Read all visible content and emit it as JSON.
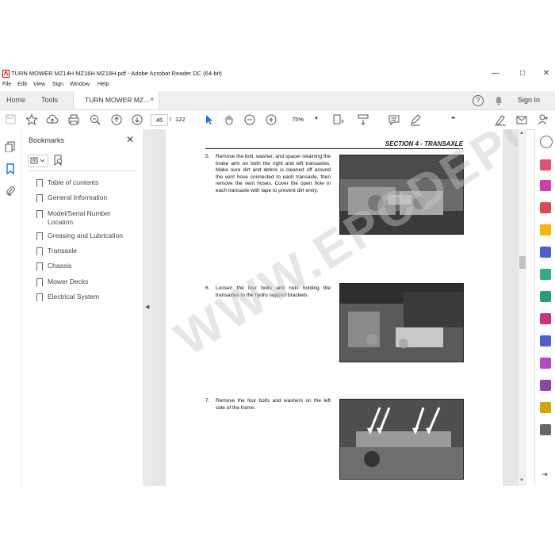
{
  "window": {
    "title": "TURN MOWER MZ14H MZ16H MZ18H.pdf - Adobe Acrobat Reader DC (64-bit)",
    "minimize": "—",
    "maximize": "□",
    "close": "✕"
  },
  "menu": [
    "File",
    "Edit",
    "View",
    "Sign",
    "Window",
    "Help"
  ],
  "tabs": {
    "home": "Home",
    "tools": "Tools",
    "doc": "TURN MOWER MZ...",
    "doc_close": "×",
    "sign_in": "Sign In"
  },
  "toolbar": {
    "page_current": "45",
    "page_sep": "/",
    "page_total": "122",
    "zoom": "75%",
    "more": "•••"
  },
  "bookmarks": {
    "title": "Bookmarks",
    "close": "✕",
    "items": [
      "Table of contents",
      "General Information",
      "Model/Serial Number Location",
      "Greasing and Lubrication",
      "Transaxle",
      "Chassis",
      "Mower Decks",
      "Electrical System"
    ]
  },
  "document": {
    "section": "SECTION 4 - TRANSAXLE",
    "steps": [
      {
        "num": "5.",
        "text": "Remove the bolt, washer, and spacer retaining the brake arm on both the right and left transaxles. Make sure dirt and debris is cleaned off around the vent hose connected to each transaxle, then remove the vent hoses. Cover the open hole in each transaxle with tape to prevent dirt entry."
      },
      {
        "num": "6.",
        "text": "Loosen the four bolts and nuts holding the transaxles to the hydro support brackets."
      },
      {
        "num": "7.",
        "text": "Remove the four bolts and washers on the left side of the frame."
      }
    ],
    "watermark": "WWW.EPCDEPOT.COM"
  },
  "colors": {
    "accent": "#1473e6",
    "tab_bg": "#f0f0f0",
    "doc_bg": "#e6e6e6"
  }
}
